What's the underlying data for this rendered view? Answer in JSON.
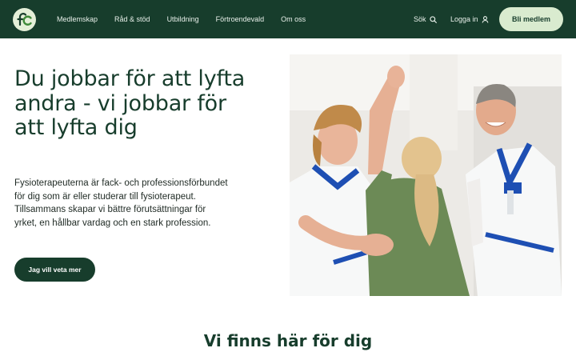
{
  "header": {
    "logo_icon": "fysioterapeuterna-logo",
    "nav": [
      {
        "label": "Medlemskap"
      },
      {
        "label": "Råd & stöd"
      },
      {
        "label": "Utbildning"
      },
      {
        "label": "Förtroendevald"
      },
      {
        "label": "Om oss"
      }
    ],
    "search_label": "Sök",
    "search_icon": "search-icon",
    "login_label": "Logga in",
    "login_icon": "user-icon",
    "join_label": "Bli medlem"
  },
  "hero": {
    "title": "Du jobbar för att lyfta andra - vi jobbar för att lyfta dig",
    "text": "Fysioterapeuterna är fack- och professionsförbundet för dig som är eller studerar till fysioterapeut. Tillsammans skapar vi bättre förutsättningar för yrket, en hållbar vardag och en stark profession.",
    "cta_label": "Jag vill veta mer"
  },
  "section": {
    "title": "Vi finns här för dig"
  },
  "colors": {
    "primary": "#173d2c",
    "accent": "#d9ebcf",
    "text": "#1f2a24"
  }
}
